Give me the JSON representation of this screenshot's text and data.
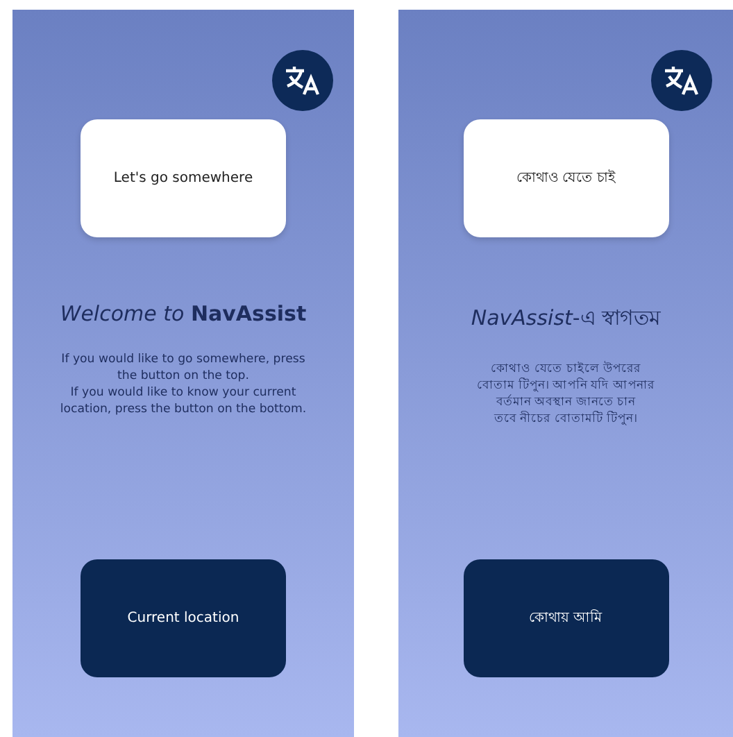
{
  "screens": [
    {
      "top_button": "Let's go somewhere",
      "title": "*Welcome to* **NavAssist**",
      "description": "If you would like to go somewhere, press\nthe  button on the top.\nIf you would like to know your current\nlocation, press the button on the bottom.",
      "bottom_button": "Current location"
    },
    {
      "top_button": "কোথাও যেতে চাই",
      "title": "*NavAssist*-এ স্বাগতম",
      "description": "কোথাও যেতে চাইলে উপরের\nবোতাম টিপুন। আপনি যদি আপনার\nবর্তমান অবস্থান জানতে চান\nতবে নীচের বোতামটি টিপুন।",
      "bottom_button": "কোথায় আমি"
    }
  ]
}
